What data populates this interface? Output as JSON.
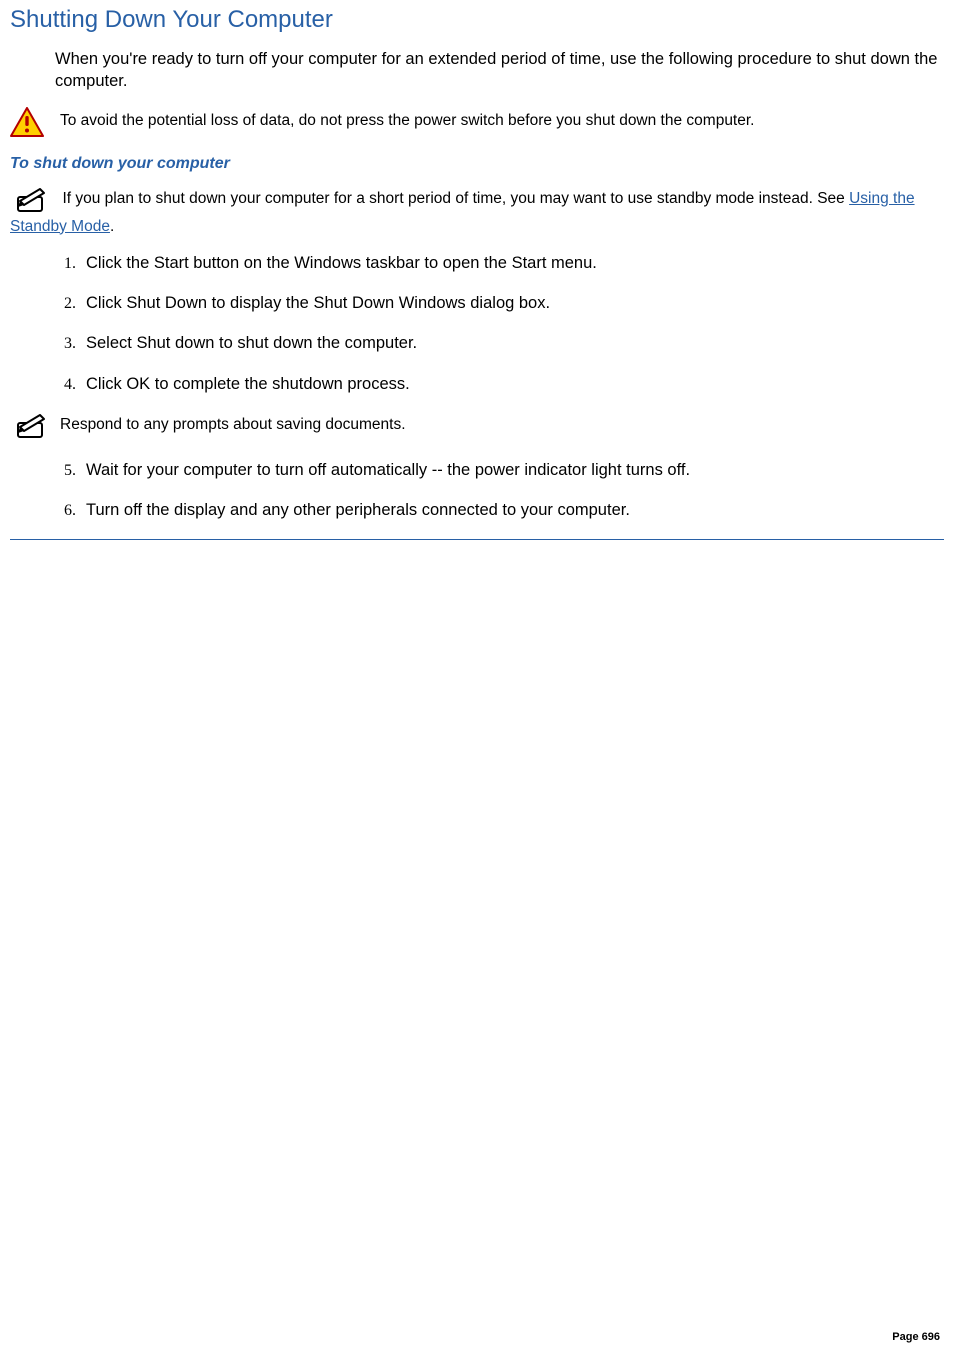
{
  "title": "Shutting Down Your Computer",
  "intro": "When you're ready to turn off your computer for an extended period of time, use the following procedure to shut down the computer.",
  "warning_text": "To avoid the potential loss of data, do not press the power switch before you shut down the computer.",
  "subhead": "To shut down your computer",
  "note1_pre": "If you plan to shut down your computer for a short period of time, you may want to use standby mode instead. See ",
  "note1_link": "Using the Standby Mode",
  "note1_post": ".",
  "steps_a": [
    "Click the Start button on the Windows taskbar to open the Start menu.",
    "Click Shut Down to display the Shut Down Windows dialog box.",
    "Select Shut down to shut down the computer.",
    "Click OK to complete the shutdown process."
  ],
  "mid_note": "Respond to any prompts about saving documents.",
  "steps_b": [
    "Wait for your computer to turn off automatically -- the power indicator light turns off.",
    "Turn off the display and any other peripherals connected to your computer."
  ],
  "page_label": "Page 696"
}
